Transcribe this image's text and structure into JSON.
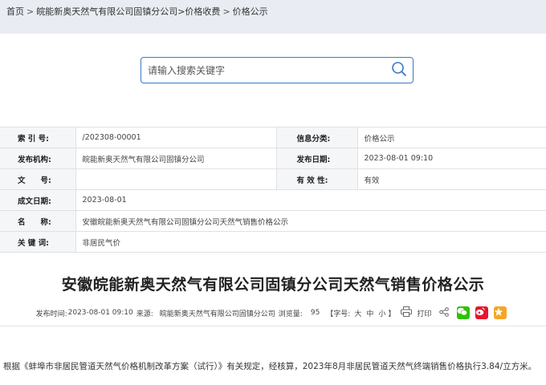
{
  "breadcrumb": {
    "home": "首页",
    "sep": ">",
    "level1": "皖能新奥天然气有限公司固镇分公司",
    "level2": ">价格收费",
    "level3": "价格公示"
  },
  "search": {
    "placeholder": "请输入搜索关键字"
  },
  "meta": {
    "index_label": "索 引 号:",
    "index_value": "/202308-00001",
    "category_label": "信息分类:",
    "category_value": "价格公示",
    "issuer_label": "发布机构:",
    "issuer_value": "皖能新奥天然气有限公司固镇分公司",
    "publish_date_label": "发布日期:",
    "publish_date_value": "2023-08-01 09:10",
    "docno_label": "文　　号:",
    "docno_value": "",
    "validity_label": "有 效 性:",
    "validity_value": "有效",
    "created_label": "成文日期:",
    "created_value": "2023-08-01",
    "name_label": "名　　称:",
    "name_value": "安徽皖能新奥天然气有限公司固镇分公司天然气销售价格公示",
    "keywords_label": "关 键 词:",
    "keywords_value": "非居民气价"
  },
  "article": {
    "title": "安徽皖能新奥天然气有限公司固镇分公司天然气销售价格公示",
    "published_label": "发布时间:",
    "published_value": "2023-08-01 09:10",
    "source_label": "来源:",
    "source_value": "皖能新奥天然气有限公司固镇分公司",
    "views_label": "浏览量:",
    "views_value": "95",
    "fontsize_open": "【字号:",
    "fontsize_large": "大",
    "fontsize_medium": "中",
    "fontsize_small": "小",
    "fontsize_close": "】",
    "print_label": "打印",
    "body": "根据《蚌埠市非居民管道天然气价格机制改革方案（试行）》有关规定，经核算，2023年8月非居民管道天然气终端销售价格执行3.84/立方米。"
  },
  "colors": {
    "breadcrumb_bg": "#e9edf3",
    "search_border": "#3b78c9",
    "wechat": "#2dc100",
    "weibo": "#e6162d",
    "qzone": "#f5a623"
  },
  "icons": {
    "search": "search-icon",
    "print": "printer-icon",
    "share": "share-icon",
    "wechat": "wechat-icon",
    "weibo": "weibo-icon",
    "qzone": "qzone-star-icon"
  }
}
